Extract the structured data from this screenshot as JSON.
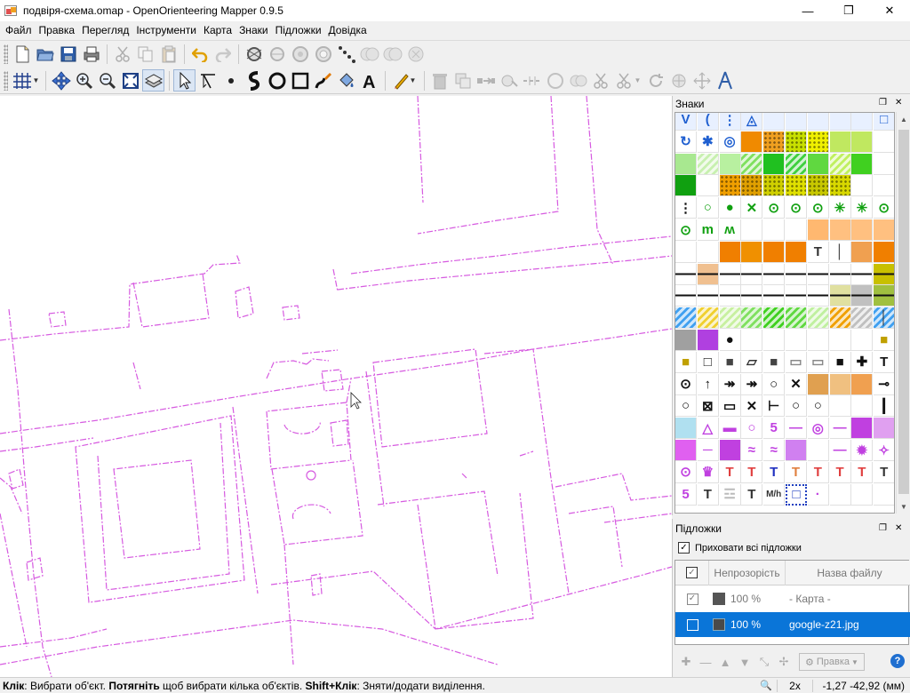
{
  "window": {
    "title": "подвіря-схема.omap - OpenOrienteering Mapper 0.9.5",
    "app_icon": "oom-app-icon",
    "controls": [
      "minimize-icon",
      "restore-icon",
      "close-icon"
    ]
  },
  "menu": [
    "Файл",
    "Правка",
    "Перегляд",
    "Інструменти",
    "Карта",
    "Знаки",
    "Підложки",
    "Довідка"
  ],
  "toolbar1": {
    "icons": [
      "new-file-icon",
      "open-file-icon",
      "save-icon",
      "print-icon",
      "cut-icon",
      "copy-icon",
      "paste-icon",
      "undo-icon",
      "redo-icon",
      "gps-icon",
      "gps-track-icon",
      "gps-marker-icon",
      "gps-marker-2-icon",
      "gps-distance-icon",
      "compass-icon",
      "compass-2-icon",
      "compass-3-icon"
    ]
  },
  "toolbar2": {
    "icons": [
      "grid-icon",
      "pan-icon",
      "zoom-in-icon",
      "zoom-out-icon",
      "show-all-icon",
      "overprint-icon",
      "edit-object-icon",
      "edit-line-icon",
      "draw-point-icon",
      "draw-path-icon",
      "draw-circle-icon",
      "draw-rectangle-icon",
      "draw-freehand-icon",
      "fill-icon",
      "draw-text-icon",
      "paint-on-template-icon",
      "delete-icon",
      "duplicate-icon",
      "switch-symbol-icon",
      "fill-border-icon",
      "switch-dashes-icon",
      "connect-paths-icon",
      "boolean-union-icon",
      "cut-object-icon",
      "cut-hole-icon",
      "rotate-icon",
      "rotate-pattern-icon",
      "measure-icon",
      "scale-icon"
    ]
  },
  "symbols_panel": {
    "title": "Знаки"
  },
  "symbol_texts": [
    "5",
    "5",
    "T",
    "T",
    "T",
    "T",
    "T",
    "T",
    "T",
    "T",
    "M/h",
    "T"
  ],
  "templates_panel": {
    "title": "Підложки",
    "hide_all_label": "Приховати всі підложки",
    "hide_all_checked": true,
    "columns": {
      "opacity": "Непрозорість",
      "filename": "Назва файлу"
    },
    "rows": [
      {
        "visible": true,
        "opacity": "100 %",
        "name": "- Карта -"
      },
      {
        "visible": false,
        "opacity": "100 %",
        "name": "google-z21.jpg"
      }
    ],
    "edit_label": "Правка"
  },
  "status": {
    "text_html": "<b>Клік</b>: Вибрати об'єкт. <b>Потягніть</b> щоб вибрати кілька об'єктів. <b>Shift+Клік</b>: Зняти/додати виділення.",
    "zoom": "2x",
    "coords": "-1,27 -42,92 (мм)"
  },
  "colors": {
    "map_line": "#d65ae0",
    "selection": "#0a75d8",
    "accent_orange": "#f07f00"
  }
}
